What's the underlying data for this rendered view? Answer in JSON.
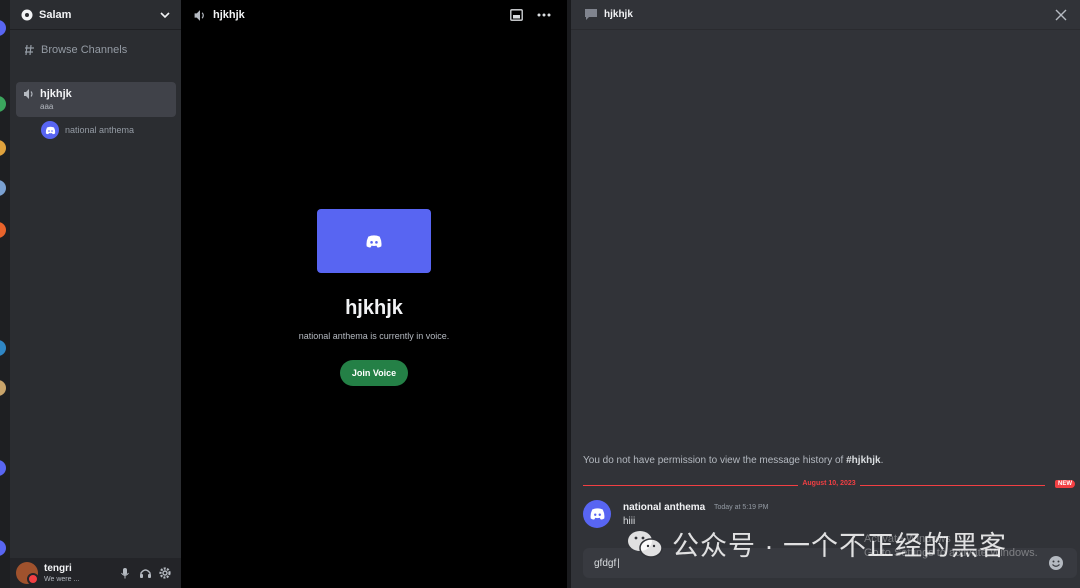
{
  "server": {
    "name": "Salam"
  },
  "sidebar": {
    "browse_label": "Browse Channels",
    "channel": {
      "name": "hjkhjk",
      "status": "aaa"
    },
    "voice_user": "national anthema"
  },
  "userbar": {
    "name": "tengri",
    "status": "We were ..."
  },
  "voice_panel": {
    "header_title": "hjkhjk",
    "title": "hjkhjk",
    "subtitle": "national anthema is currently in voice.",
    "join_label": "Join Voice"
  },
  "chat": {
    "header_title": "hjkhjk",
    "permission_prefix": "You do not have permission to view the message history of ",
    "permission_channel": "#hjkhjk",
    "permission_suffix": ".",
    "date_divider": "August 10, 2023",
    "new_badge": "NEW",
    "message": {
      "author": "national anthema",
      "time": "Today at 5:19 PM",
      "text": "hiii"
    },
    "composer_value": "gfdgf"
  },
  "overlay": {
    "watermark": "公众号 · 一个不正经的黑客",
    "activate_line1": "Activate Windows",
    "activate_line2": "Go to Settings to activate Windows."
  },
  "colors": {
    "accent": "#5865f2",
    "join": "#248046",
    "new": "#f23f43"
  }
}
